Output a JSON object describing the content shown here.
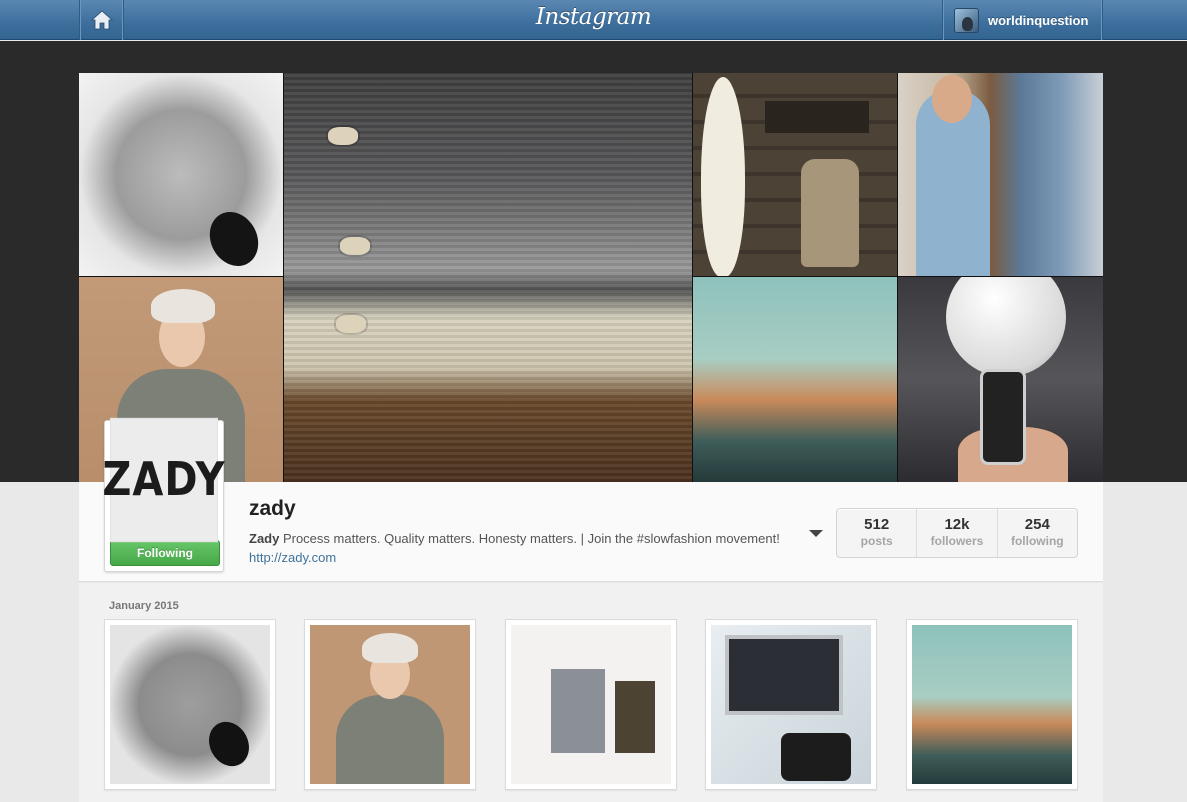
{
  "topbar": {
    "logo": "Instagram",
    "home_icon": "home-icon",
    "current_user": "worldinquestion"
  },
  "profile": {
    "avatar_text": "ZADY",
    "follow_label": "Following",
    "username": "zady",
    "bio_name": "Zady",
    "bio_text": " Process matters. Quality matters. Honesty matters. | Join the #slowfashion movement! ",
    "bio_link": "http://zady.com",
    "stats": [
      {
        "value": "512",
        "label": "posts"
      },
      {
        "value": "12k",
        "label": "followers"
      },
      {
        "value": "254",
        "label": "following"
      }
    ]
  },
  "feed": {
    "month": "January 2015"
  },
  "colors": {
    "topbar": "#3d6e9c",
    "follow_green": "#45a847",
    "link": "#3f729b"
  }
}
